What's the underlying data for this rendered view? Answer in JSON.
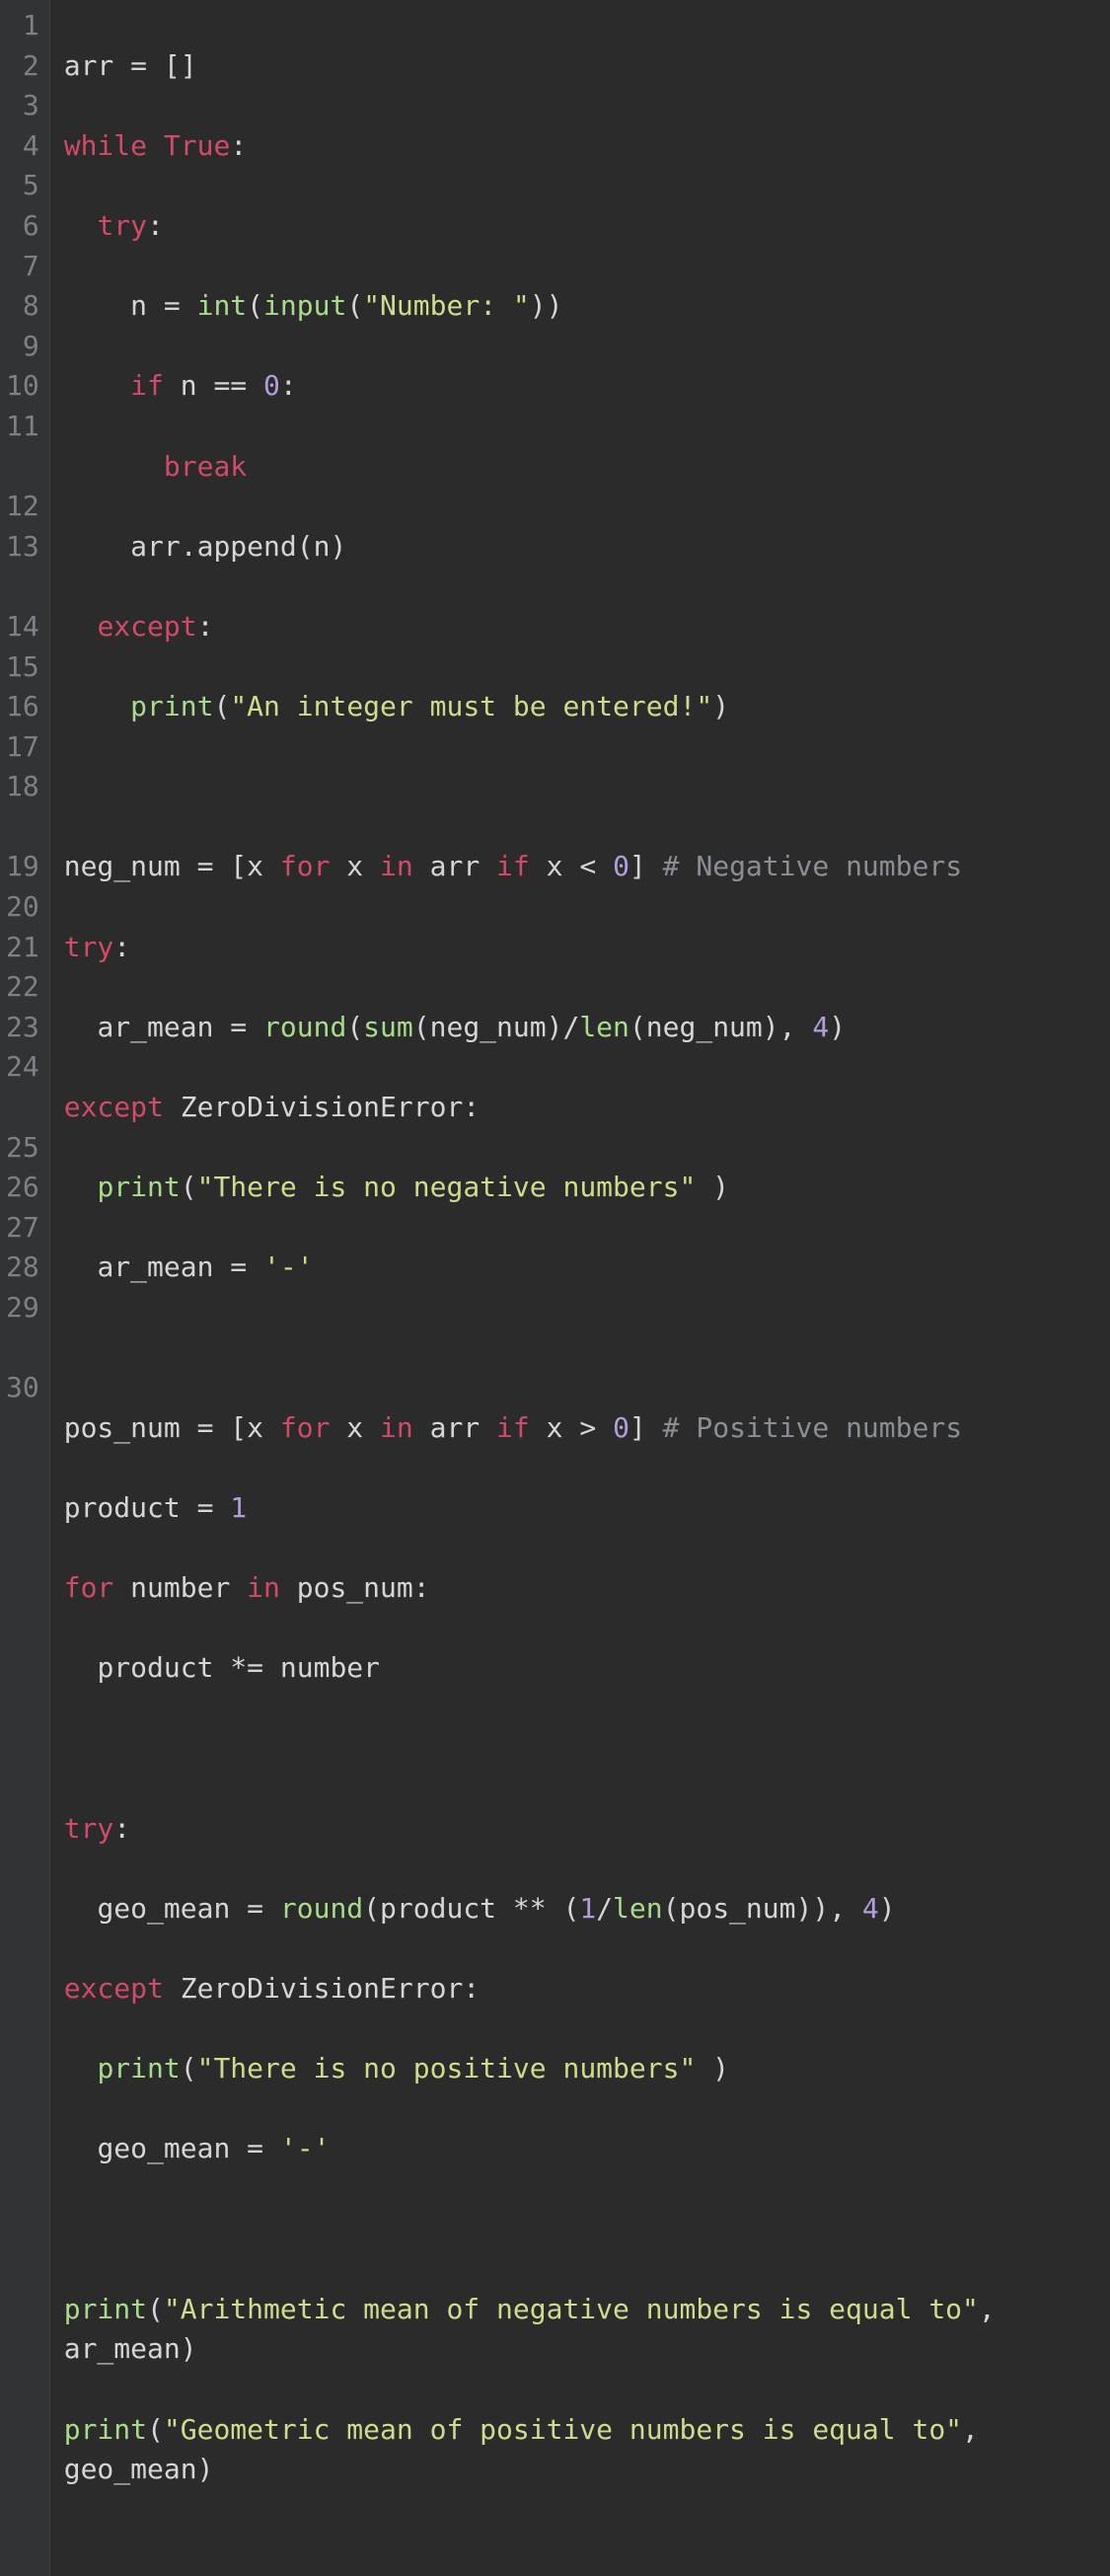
{
  "gutter": [
    "1",
    "2",
    "3",
    "4",
    "5",
    "6",
    "7",
    "8",
    "9",
    "10",
    "11",
    "12",
    "13",
    "14",
    "15",
    "16",
    "17",
    "18",
    "19",
    "20",
    "21",
    "22",
    "23",
    "24",
    "25",
    "26",
    "27",
    "28",
    "29",
    "30"
  ],
  "code": {
    "l1": {
      "a": "arr = []"
    },
    "l2": {
      "a": "while",
      "b": " True:",
      "kw": "while",
      "bool": "True",
      "rest": ":"
    },
    "l3": {
      "indent": "  ",
      "kw": "try",
      "colon": ":"
    },
    "l4": {
      "indent": "    ",
      "a": "n = ",
      "fn1": "int",
      "b": "(",
      "fn2": "input",
      "c": "(",
      "str": "\"Number: \"",
      "d": "))"
    },
    "l5": {
      "indent": "    ",
      "kw": "if",
      "a": " n == ",
      "num": "0",
      "b": ":"
    },
    "l6": {
      "indent": "      ",
      "kw": "break"
    },
    "l7": {
      "indent": "    ",
      "a": "arr.append(n)"
    },
    "l8": {
      "indent": "  ",
      "kw": "except",
      "a": ":"
    },
    "l9": {
      "indent": "    ",
      "fn": "print",
      "a": "(",
      "str": "\"An integer must be entered!\"",
      "b": ")"
    },
    "l10": {
      "a": ""
    },
    "l11": {
      "a": "neg_num = [x ",
      "kw1": "for",
      "b": " x ",
      "kw2": "in",
      "c": " arr ",
      "kw3": "if",
      "d": " x < ",
      "num": "0",
      "e": "] ",
      "cmt": "# Negative numbers"
    },
    "l12": {
      "kw": "try",
      "a": ":"
    },
    "l13": {
      "indent": "  ",
      "a": "ar_mean = ",
      "fn1": "round",
      "b": "(",
      "fn2": "sum",
      "c": "(neg_num)/",
      "fn3": "len",
      "d": "(neg_num), ",
      "num": "4",
      "e": ")"
    },
    "l14": {
      "kw": "except",
      "a": " ZeroDivisionError:"
    },
    "l15": {
      "indent": "  ",
      "fn": "print",
      "a": "(",
      "str": "\"There is no negative numbers\"",
      "b": " )"
    },
    "l16": {
      "indent": "  ",
      "a": "ar_mean = ",
      "str": "'-'"
    },
    "l17": {
      "a": ""
    },
    "l18": {
      "a": "pos_num = [x ",
      "kw1": "for",
      "b": " x ",
      "kw2": "in",
      "c": " arr ",
      "kw3": "if",
      "d": " x > ",
      "num": "0",
      "e": "] ",
      "cmt": "# Positive numbers"
    },
    "l19": {
      "a": "product = ",
      "num": "1"
    },
    "l20": {
      "kw1": "for",
      "a": " number ",
      "kw2": "in",
      "b": " pos_num:"
    },
    "l21": {
      "indent": "  ",
      "a": "product *= number"
    },
    "l22": {
      "a": ""
    },
    "l23": {
      "kw": "try",
      "a": ":"
    },
    "l24": {
      "indent": "  ",
      "a": "geo_mean = ",
      "fn1": "round",
      "b": "(product ** (",
      "num1": "1",
      "c": "/",
      "fn2": "len",
      "d": "(pos_num)), ",
      "num2": "4",
      "e": ")"
    },
    "l25": {
      "kw": "except",
      "a": " ZeroDivisionError:"
    },
    "l26": {
      "indent": "  ",
      "fn": "print",
      "a": "(",
      "str": "\"There is no positive numbers\"",
      "b": " )"
    },
    "l27": {
      "indent": "  ",
      "a": "geo_mean = ",
      "str": "'-'"
    },
    "l28": {
      "a": ""
    },
    "l29": {
      "fn": "print",
      "a": "(",
      "str": "\"Arithmetic mean of negative numbers is equal to\"",
      "b": ", ar_mean)"
    },
    "l30": {
      "fn": "print",
      "a": "(",
      "str": "\"Geometric mean of positive numbers is equal to\"",
      "b": ", geo_mean)"
    }
  }
}
